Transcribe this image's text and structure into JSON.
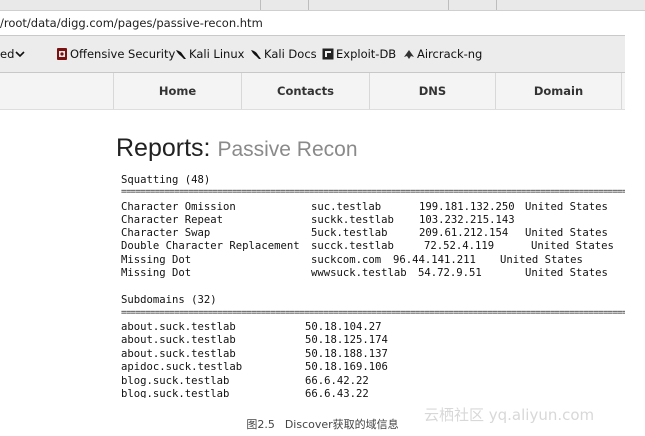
{
  "browser": {
    "url": "/root/data/digg.com/pages/passive-recon.htm",
    "bookmarks": [
      {
        "label": "ed",
        "icon": "chevron-down-icon"
      },
      {
        "label": "Offensive Security",
        "icon": "offsec-icon"
      },
      {
        "label": "Kali Linux",
        "icon": "kali-dragon-icon"
      },
      {
        "label": "Kali Docs",
        "icon": "kali-dragon-icon"
      },
      {
        "label": "Exploit-DB",
        "icon": "exploitdb-icon"
      },
      {
        "label": "Aircrack-ng",
        "icon": "aircrack-icon"
      }
    ]
  },
  "nav": {
    "items": [
      "Home",
      "Contacts",
      "DNS",
      "Domain"
    ]
  },
  "page": {
    "title": "Reports:",
    "subtitle": "Passive Recon"
  },
  "squatting": {
    "header": "Squatting (48)",
    "rule": "==========================================================================================================",
    "rows": [
      {
        "type": "Character Omission",
        "domain": "suc.testlab",
        "ip": "199.181.132.250",
        "country": "United States"
      },
      {
        "type": "Character Repeat",
        "domain": "suckk.testlab",
        "ip": "103.232.215.143",
        "country": ""
      },
      {
        "type": "Character Swap",
        "domain": "5uck.testlab",
        "ip": "209.61.212.154",
        "country": "United States"
      },
      {
        "type": "Double Character Replacement",
        "domain": "succk.testlab",
        "ip": "72.52.4.119",
        "country": "United States"
      },
      {
        "type": "Missing Dot",
        "domain": "suckcom.com",
        "ip": "96.44.141.211",
        "country": "United States"
      },
      {
        "type": "Missing Dot",
        "domain": "wwwsuck.testlab",
        "ip": "54.72.9.51",
        "country": "United States"
      }
    ]
  },
  "subdomains": {
    "header": "Subdomains (32)",
    "rule": "==========================================================================================================",
    "rows": [
      {
        "host": "about.suck.testlab",
        "ip": "50.18.104.27"
      },
      {
        "host": "about.suck.testlab",
        "ip": "50.18.125.174"
      },
      {
        "host": "about.suck.testlab",
        "ip": "50.18.188.137"
      },
      {
        "host": "apidoc.suck.testlab",
        "ip": "50.18.169.106"
      },
      {
        "host": "blog.suck.testlab",
        "ip": "66.6.42.22"
      },
      {
        "host": "blog.suck.testlab",
        "ip": "66.6.43.22"
      }
    ]
  },
  "caption": {
    "figure": "图2.5",
    "text": "Discover获取的域信息"
  },
  "watermark": "云栖社区 yq.aliyun.com"
}
